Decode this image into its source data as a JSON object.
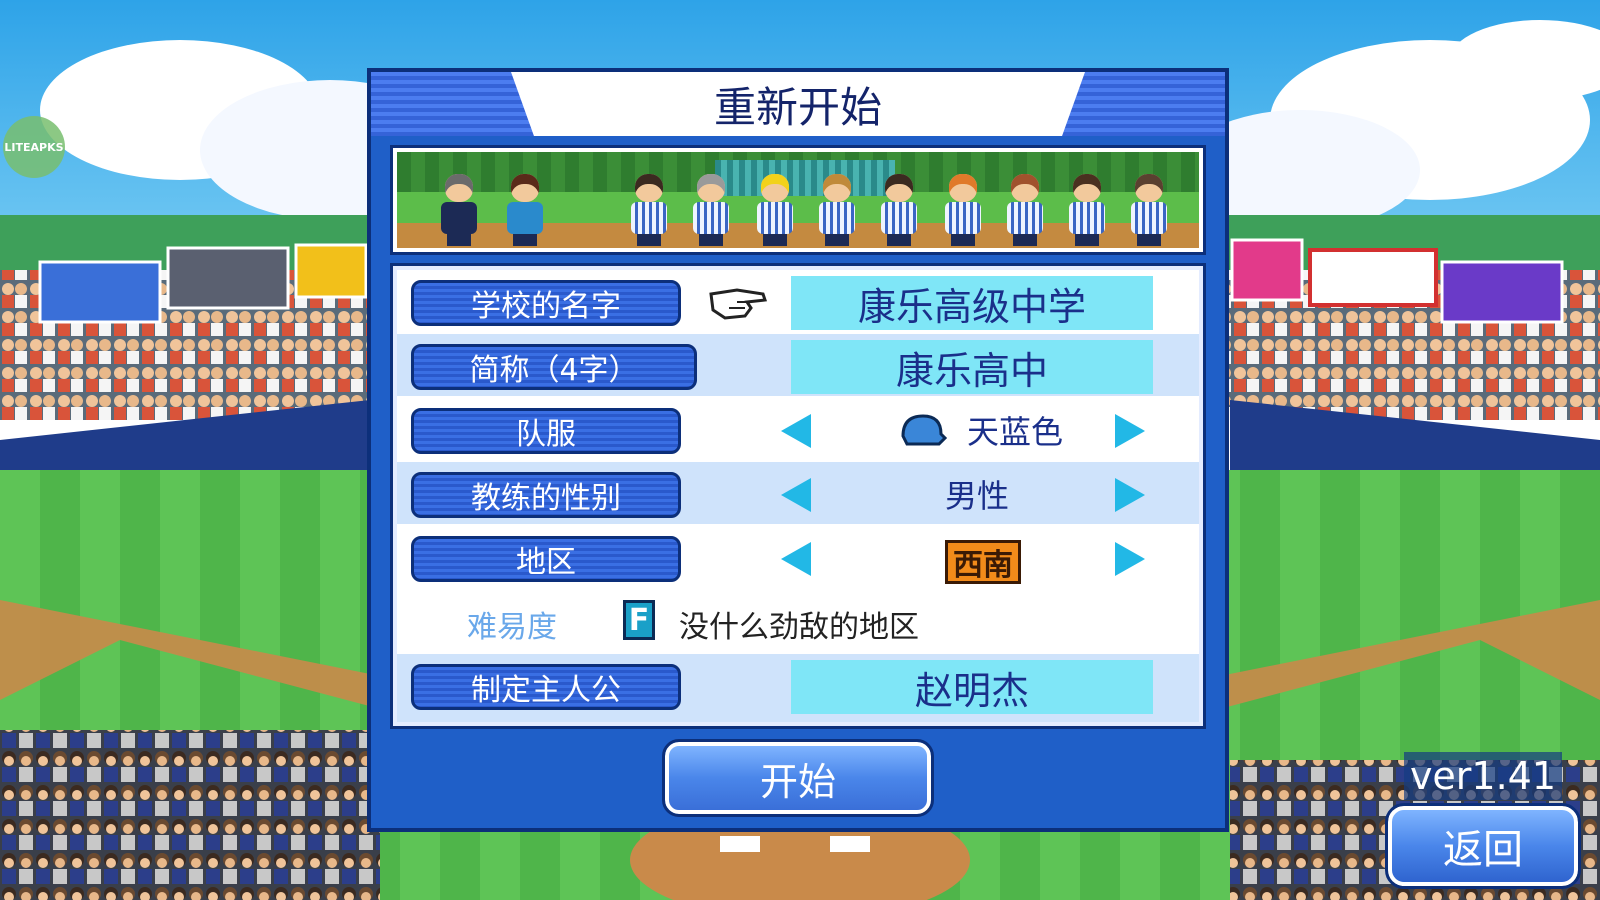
{
  "watermark": "LITEAPKS",
  "dialog": {
    "title": "重新开始",
    "fields": {
      "school_name": {
        "label": "学校的名字",
        "value": "康乐高级中学"
      },
      "short_name": {
        "label": "简称（4字）",
        "value": "康乐高中"
      },
      "uniform": {
        "label": "队服",
        "value": "天蓝色"
      },
      "coach_gender": {
        "label": "教练的性别",
        "value": "男性"
      },
      "region": {
        "label": "地区",
        "value": "西南"
      },
      "difficulty": {
        "label": "难易度",
        "grade": "F",
        "text": "没什么劲敌的地区"
      },
      "protagonist": {
        "label": "制定主人公",
        "value": "赵明杰"
      }
    },
    "start_label": "开始"
  },
  "version": "ver1.41",
  "back_label": "返回",
  "colors": {
    "panel": "#1f5fc8",
    "value_box": "#7fe6f7",
    "arrow": "#22b8e6",
    "region_badge": "#f28b1a"
  },
  "icons": [
    "pointing-hand-icon",
    "arrow-left-icon",
    "arrow-right-icon",
    "cap-icon"
  ]
}
